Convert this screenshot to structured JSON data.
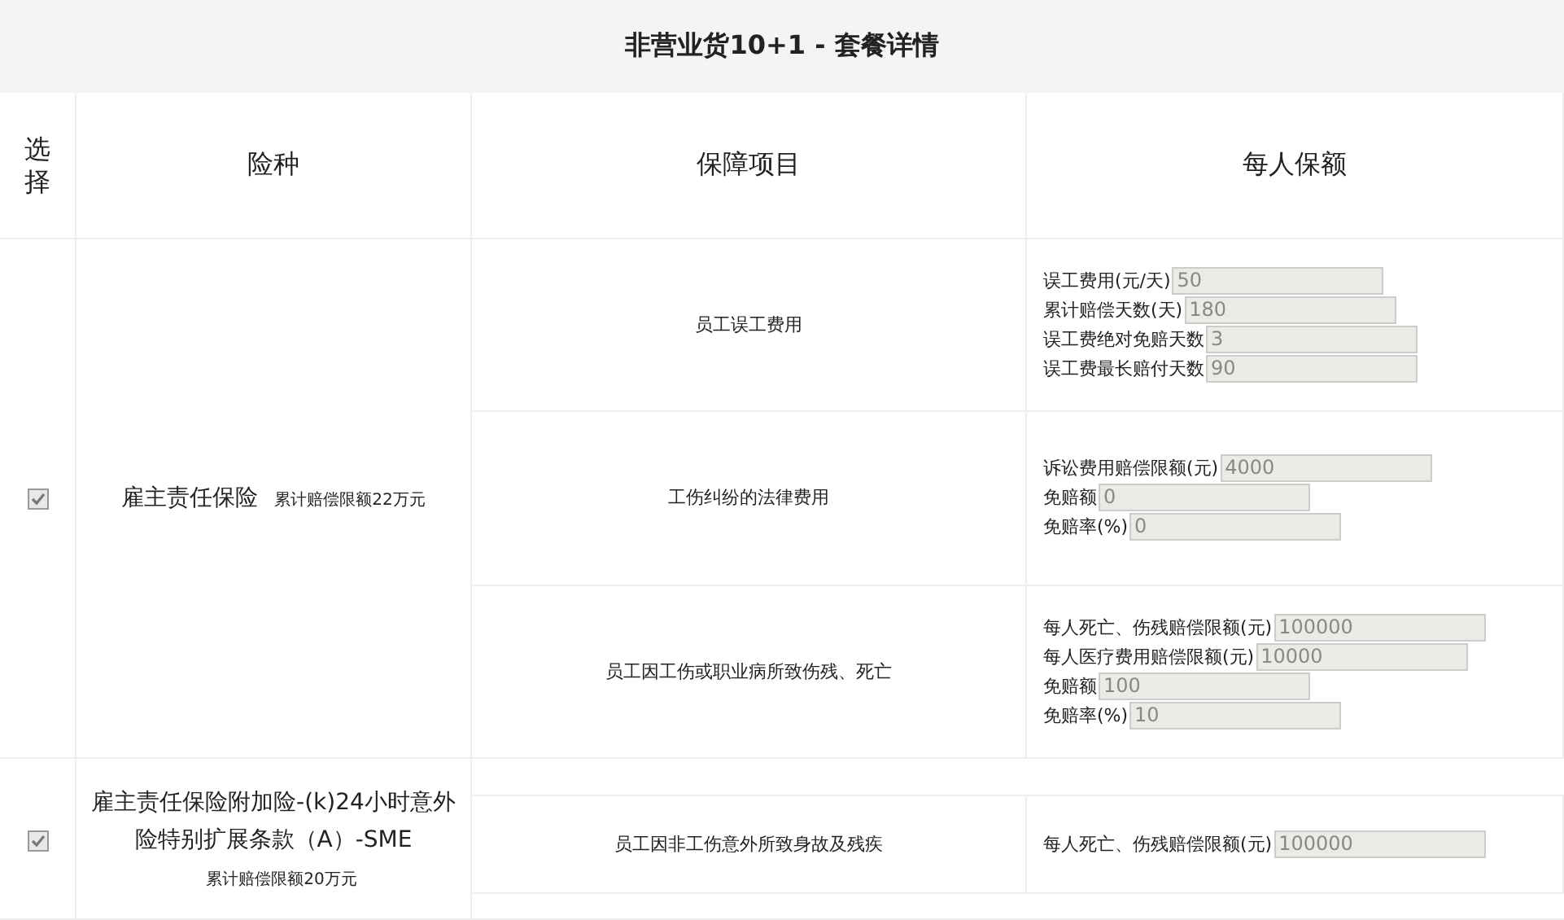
{
  "title": "非营业货10+1 - 套餐详情",
  "columns": [
    "选择",
    "险种",
    "保障项目",
    "每人保额"
  ],
  "plans": [
    {
      "checked": true,
      "name": "雇主责任保险",
      "limit": "累计赔偿限额22万元",
      "items": [
        {
          "name": "员工误工费用",
          "fields": [
            {
              "label": "误工费用(元/天)",
              "value": "50"
            },
            {
              "label": "累计赔偿天数(天)",
              "value": "180"
            },
            {
              "label": "误工费绝对免赔天数",
              "value": "3"
            },
            {
              "label": "误工费最长赔付天数",
              "value": "90"
            }
          ]
        },
        {
          "name": "工伤纠纷的法律费用",
          "fields": [
            {
              "label": "诉讼费用赔偿限额(元)",
              "value": "4000"
            },
            {
              "label": "免赔额",
              "value": "0"
            },
            {
              "label": "免赔率(%)",
              "value": "0"
            }
          ]
        },
        {
          "name": "员工因工伤或职业病所致伤残、死亡",
          "fields": [
            {
              "label": "每人死亡、伤残赔偿限额(元)",
              "value": "100000"
            },
            {
              "label": "每人医疗费用赔偿限额(元)",
              "value": "10000"
            },
            {
              "label": "免赔额",
              "value": "100"
            },
            {
              "label": "免赔率(%)",
              "value": "10"
            }
          ]
        }
      ]
    },
    {
      "checked": true,
      "name": "雇主责任保险附加险-(k)24小时意外险特别扩展条款（A）-SME",
      "limit": "累计赔偿限额20万元",
      "items": [
        {
          "name": "员工因非工伤意外所致身故及残疾",
          "fields": [
            {
              "label": "每人死亡、伤残赔偿限额(元)",
              "value": "100000"
            }
          ]
        }
      ]
    }
  ]
}
